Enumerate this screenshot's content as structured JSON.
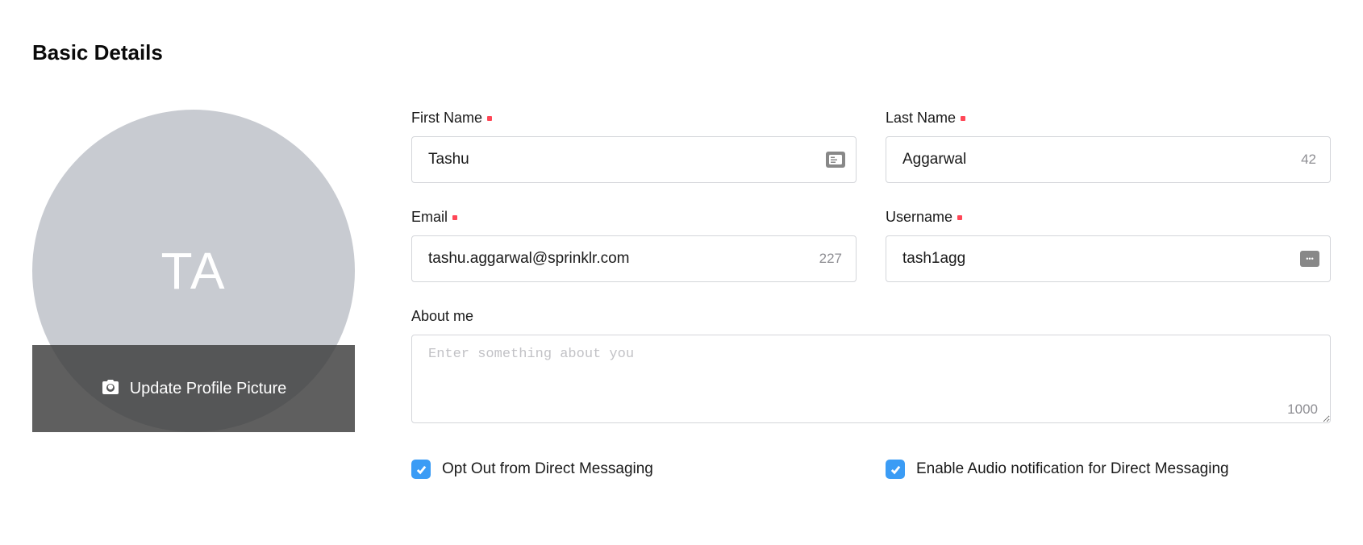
{
  "title": "Basic Details",
  "avatar": {
    "initials": "TA",
    "update_label": "Update Profile Picture"
  },
  "fields": {
    "first_name": {
      "label": "First Name",
      "value": "Tashu",
      "required": true
    },
    "last_name": {
      "label": "Last Name",
      "value": "Aggarwal",
      "counter": "42",
      "required": true
    },
    "email": {
      "label": "Email",
      "value": "tashu.aggarwal@sprinklr.com",
      "counter": "227",
      "required": true
    },
    "username": {
      "label": "Username",
      "value": "tash1agg",
      "required": true
    },
    "about_me": {
      "label": "About me",
      "value": "",
      "placeholder": "Enter something about you",
      "counter": "1000"
    }
  },
  "checkboxes": {
    "opt_out": {
      "label": "Opt Out from Direct Messaging",
      "checked": true
    },
    "audio_notif": {
      "label": "Enable Audio notification for Direct Messaging",
      "checked": true
    }
  }
}
